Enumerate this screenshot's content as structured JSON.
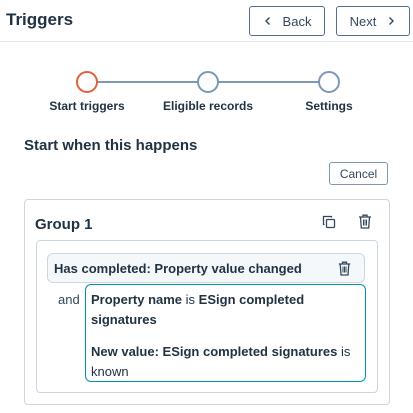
{
  "header": {
    "title": "Triggers",
    "back_label": "Back",
    "next_label": "Next"
  },
  "stepper": {
    "steps": [
      {
        "label": "Start triggers",
        "state": "active"
      },
      {
        "label": "Eligible records",
        "state": "upcoming"
      },
      {
        "label": "Settings",
        "state": "upcoming"
      }
    ],
    "active_color": "#e0623b",
    "inactive_color": "#7c98b6"
  },
  "section": {
    "title": "Start when this happens",
    "cancel_label": "Cancel"
  },
  "group": {
    "title": "Group 1",
    "filter": {
      "text": "Has completed: Property value changed"
    },
    "connector": "and",
    "condition": {
      "property_label": "Property name",
      "property_is": " is ",
      "property_value": "ESign completed signatures",
      "new_value_label": "New value: ESign completed signatures",
      "new_value_is": " is known"
    }
  }
}
